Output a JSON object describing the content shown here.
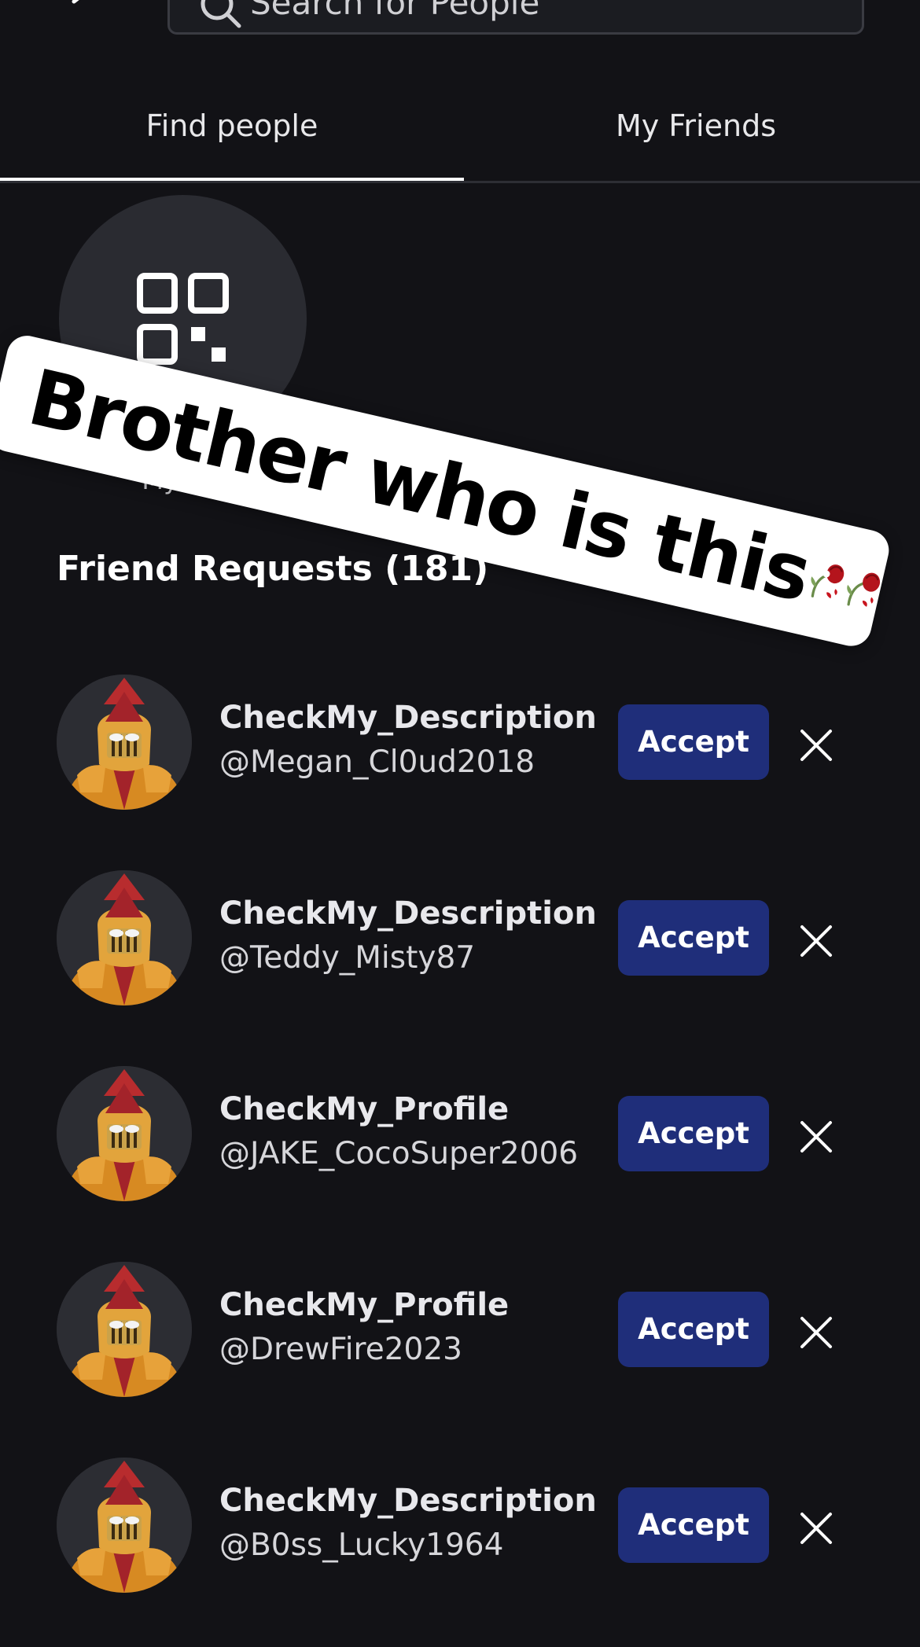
{
  "search": {
    "placeholder": "Search for People"
  },
  "tabs": [
    {
      "label": "Find people",
      "active": true
    },
    {
      "label": "My Friends",
      "active": false
    }
  ],
  "qr": {
    "label": "My QR"
  },
  "overlay": {
    "text": "Brother who is this",
    "emoji": [
      "wilted-rose",
      "wilted-rose"
    ]
  },
  "friend_requests": {
    "title": "Friend Requests (181)",
    "accept_label": "Accept",
    "items": [
      {
        "display_name": "CheckMy_Description",
        "username": "@Megan_Cl0ud2018"
      },
      {
        "display_name": "CheckMy_Description",
        "username": "@Teddy_Misty87"
      },
      {
        "display_name": "CheckMy_Profile",
        "username": "@JAKE_CocoSuper2006"
      },
      {
        "display_name": "CheckMy_Profile",
        "username": "@DrewFire2023"
      },
      {
        "display_name": "CheckMy_Description",
        "username": "@B0ss_Lucky1964"
      }
    ]
  },
  "colors": {
    "background": "#121216",
    "accept_button": "#1f2e7a",
    "tab_underline": "#ffffff"
  }
}
